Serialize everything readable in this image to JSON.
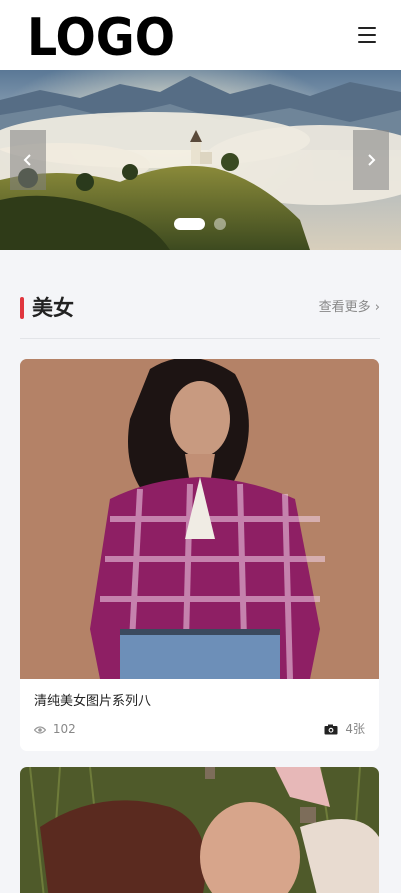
{
  "header": {
    "logo_text": "LOGO",
    "menu_icon": "hamburger-menu-icon"
  },
  "banner": {
    "prev_icon": "chevron-left-icon",
    "next_icon": "chevron-right-icon",
    "slide_count": 2,
    "active_slide": 1
  },
  "section": {
    "title": "美女",
    "more_label": "查看更多",
    "more_icon": "chevron-right-icon",
    "accent_color": "#e0363e"
  },
  "cards": [
    {
      "title": "清纯美女图片系列八",
      "views": "102",
      "views_icon": "eye-icon",
      "count": "4张",
      "count_icon": "camera-icon"
    }
  ]
}
